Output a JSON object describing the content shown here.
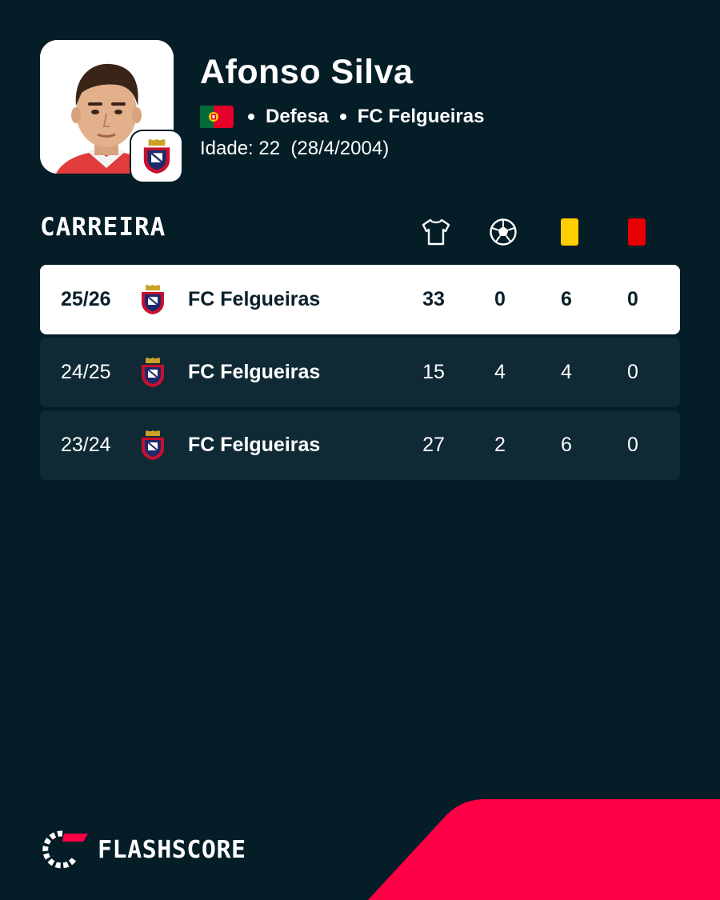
{
  "player": {
    "name": "Afonso Silva",
    "position": "Defesa",
    "club": "FC Felgueiras",
    "age_text": "Idade: 22  (28/4/2004)",
    "flag_icon": "portugal-flag-icon"
  },
  "career": {
    "title": "CARREIRA",
    "columns": [
      {
        "icon": "shirt-icon",
        "meaning": "apps"
      },
      {
        "icon": "football-icon",
        "meaning": "goals"
      },
      {
        "icon": "yellow-card-icon",
        "color": "#ffcd00"
      },
      {
        "icon": "red-card-icon",
        "color": "#e60000"
      }
    ],
    "rows": [
      {
        "season": "25/26",
        "team": "FC Felgueiras",
        "apps": "33",
        "goals": "0",
        "yellow": "6",
        "red": "0"
      },
      {
        "season": "24/25",
        "team": "FC Felgueiras",
        "apps": "15",
        "goals": "4",
        "yellow": "4",
        "red": "0"
      },
      {
        "season": "23/24",
        "team": "FC Felgueiras",
        "apps": "27",
        "goals": "2",
        "yellow": "6",
        "red": "0"
      }
    ]
  },
  "footer": {
    "brand": "FLASHSCORE",
    "accent_color": "#ff0046"
  },
  "colors": {
    "background": "#041d27",
    "row_background": "#0f2a35",
    "highlight_row": "#ffffff"
  }
}
